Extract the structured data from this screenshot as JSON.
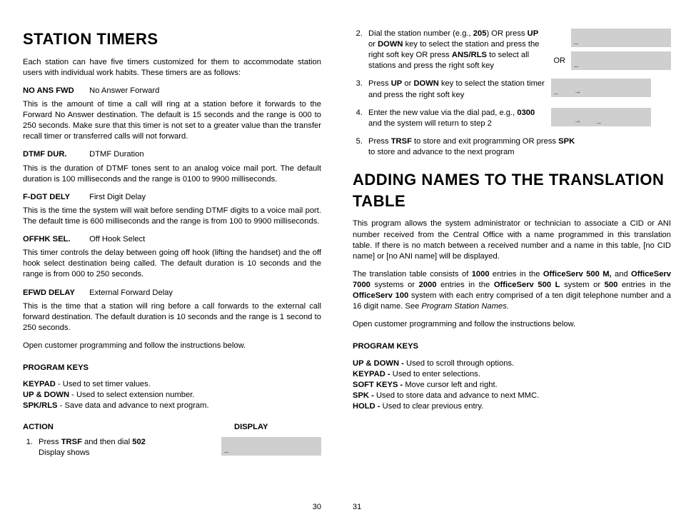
{
  "left": {
    "h1": "STATION TIMERS",
    "intro": "Each station can have five timers customized for them to accommodate station users with individual work habits. These timers are as follows:",
    "timers": [
      {
        "term": "NO ANS FWD",
        "name": "No Answer Forward",
        "desc": "This is the amount of time a call will ring at a station before it forwards to the Forward No Answer destination. The default is 15 seconds and the range is 000 to 250 seconds. Make sure that this timer is not set to a greater value than the transfer recall timer or transferred calls will not forward."
      },
      {
        "term": "DTMF DUR.",
        "name": "DTMF Duration",
        "desc": "This is the duration of DTMF tones sent to an analog voice mail port. The default duration is 100 milliseconds and the range is 0100 to 9900 milliseconds."
      },
      {
        "term": "F-DGT DELY",
        "name": "First Digit Delay",
        "desc": "This is the time the system will wait before sending DTMF digits to a voice mail port. The default time is 600 milliseconds and the range is from 100 to 9900 milliseconds."
      },
      {
        "term": "OFFHK SEL.",
        "name": "Off Hook Select",
        "desc": "This timer controls the delay between going off hook (lifting the handset) and the off hook select destination being called. The default duration is 10 seconds and the range is from 000 to 250 seconds."
      },
      {
        "term": "EFWD DELAY",
        "name": "External Forward Delay",
        "desc": "This is the time that a station will ring before a call forwards to the external call forward destination. The default duration is 10 seconds and the range is 1 second to 250 seconds."
      }
    ],
    "open_cp": "Open customer programming and follow the instructions below.",
    "pk_h": "PROGRAM KEYS",
    "pk_lines": [
      [
        "KEYPAD",
        " - Used to set timer values."
      ],
      [
        "UP & DOWN",
        " - Used to select extension number."
      ],
      [
        "SPK/RLS",
        " - Save data and advance to next program."
      ]
    ],
    "col_a": "ACTION",
    "col_d": "DISPLAY",
    "step1_pre": "Press ",
    "step1_b1": "TRSF",
    "step1_mid": " and then dial ",
    "step1_b2": "502",
    "step1_post": "Display shows",
    "disp1": "             \n_            ",
    "pagenum": "30"
  },
  "right": {
    "steps": [
      {
        "n": "2.",
        "html": "Dial the station number (e.g., <b>205</b>) OR press <b>UP</b> or <b>DOWN</b> key to select the station and press the right soft key OR press <b>ANS/RLS</b> to select all stations and press the right soft key",
        "disps": [
          "            \n_           ",
          "            \n_           "
        ],
        "or": "OR"
      },
      {
        "n": "3.",
        "html": "Press <b>UP</b> or <b>DOWN</b> key to select the station timer and press the right soft key",
        "disps": [
          "            \n_    →      "
        ]
      },
      {
        "n": "4.",
        "html": "Enter the new value via the dial pad, e.g., <b>0300</b> and the system will return to step 2",
        "disps": [
          "            \n     →    _ "
        ]
      },
      {
        "n": "5.",
        "html": "Press <b>TRSF</b> to store and exit programming OR press <b>SPK</b> to store and advance to the next program",
        "disps": []
      }
    ],
    "h1": "ADDING NAMES TO THE TRANSLATION TABLE",
    "p1": "This program allows the system administrator or technician to associate a CID or ANI number received from the Central Office with a name programmed in this translation table. If there is no match between a received number and a name in this table, [no CID name] or [no ANI name] will be displayed.",
    "p2": "The translation table consists of <b>1000</b> entries in the <b>OfficeServ 500 M,</b> and <b>OfficeServ 7000</b> systems or <b>2000</b> entries in the <b>OfficeServ 500 L</b> system or <b>500</b> entries in the <b>OfficeServ 100</b> system with each entry comprised of a ten digit telephone number and a 16 digit name. See <i>Program Station Names</i>.",
    "p3": "Open customer programming and follow the instructions below.",
    "pk_h": "PROGRAM KEYS",
    "pk_lines": [
      [
        "UP & DOWN - ",
        "Used to scroll through options."
      ],
      [
        "KEYPAD - ",
        "Used to enter selections."
      ],
      [
        "SOFT KEYS - ",
        "Move cursor left and right."
      ],
      [
        "SPK - ",
        "Used to store data and advance to next MMC."
      ],
      [
        "HOLD - ",
        "Used to clear previous entry."
      ]
    ],
    "pagenum": "31"
  }
}
